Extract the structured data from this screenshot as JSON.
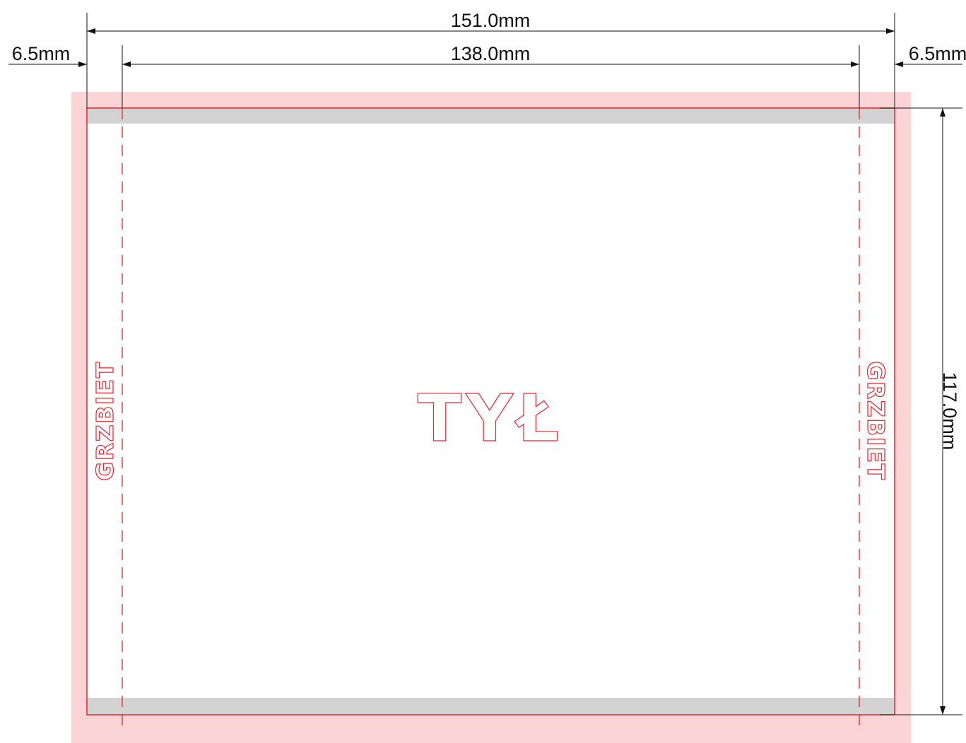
{
  "dimensions": {
    "total_width": "151.0mm",
    "inner_width": "138.0mm",
    "left_spine": "6.5mm",
    "right_spine": "6.5mm",
    "height": "117.0mm"
  },
  "labels": {
    "center": "TYŁ",
    "spine_left": "GRZBIET",
    "spine_right": "GRZBIET"
  },
  "colors": {
    "bleed": "#fbd5d6",
    "trim_line": "#e8242b",
    "fold_band": "#d3d3d3",
    "dimension_line": "#111111"
  }
}
